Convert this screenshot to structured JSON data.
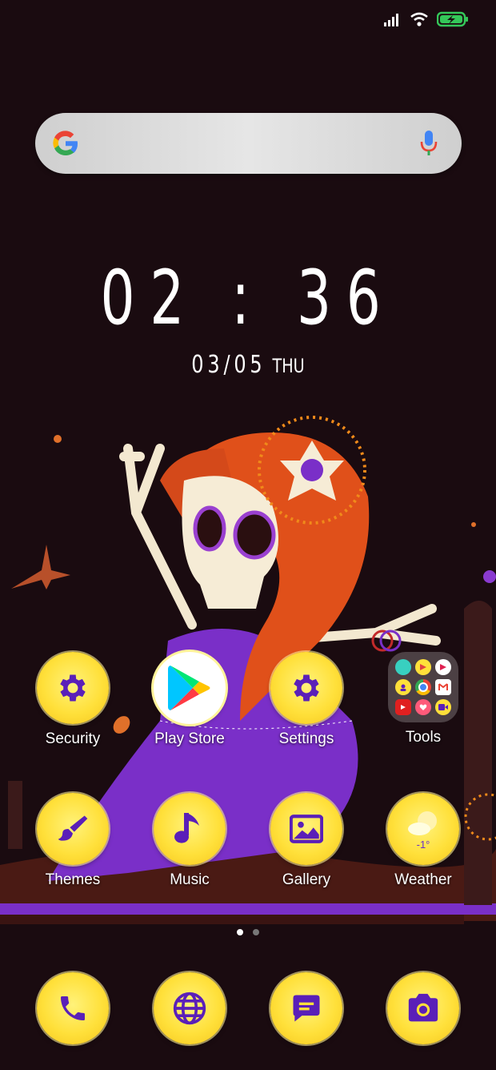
{
  "status": {
    "signal_icon": "signal-icon",
    "wifi_icon": "wifi-icon",
    "battery_icon": "battery-charging-icon"
  },
  "search": {
    "placeholder": ""
  },
  "clock": {
    "time": "02 : 36",
    "date": "03/05",
    "day": "THU"
  },
  "apps_row1": [
    {
      "label": "Security",
      "icon": "gear-icon"
    },
    {
      "label": "Play Store",
      "icon": "play-store-icon"
    },
    {
      "label": "Settings",
      "icon": "gear-icon"
    },
    {
      "label": "Tools",
      "icon": "folder-icon"
    }
  ],
  "apps_row2": [
    {
      "label": "Themes",
      "icon": "paintbrush-icon"
    },
    {
      "label": "Music",
      "icon": "music-note-icon"
    },
    {
      "label": "Gallery",
      "icon": "image-icon"
    },
    {
      "label": "Weather",
      "icon": "weather-icon",
      "temp": "-1°"
    }
  ],
  "dock": [
    {
      "icon": "phone-icon"
    },
    {
      "icon": "browser-globe-icon"
    },
    {
      "icon": "messages-icon"
    },
    {
      "icon": "camera-icon"
    }
  ],
  "pages": {
    "count": 2,
    "current": 1
  },
  "colors": {
    "accent": "#5a1fb8",
    "icon_bg": "#ffe03a",
    "wallpaper": "#1a0b10"
  }
}
